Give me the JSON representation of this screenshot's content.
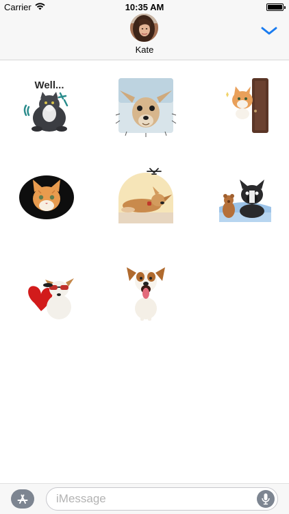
{
  "status_bar": {
    "carrier": "Carrier",
    "time": "10:35 AM",
    "icons": [
      "wifi-icon",
      "battery-icon"
    ],
    "battery_level": 1.0
  },
  "header": {
    "contact_name": "Kate",
    "collapse_icon": "chevron-down-icon",
    "accent_color": "#1a7cf0"
  },
  "stickers": [
    {
      "name": "sticker-fat-cat-well",
      "caption": "Well..."
    },
    {
      "name": "sticker-chihuahua-closeup",
      "caption": ""
    },
    {
      "name": "sticker-cat-peeking-door",
      "caption": ""
    },
    {
      "name": "sticker-kitten-oval",
      "caption": ""
    },
    {
      "name": "sticker-dog-lying",
      "caption": ""
    },
    {
      "name": "sticker-bulldog-teddy",
      "caption": ""
    },
    {
      "name": "sticker-dog-sunglasses-heart",
      "caption": ""
    },
    {
      "name": "sticker-jack-russell-tongue",
      "caption": ""
    }
  ],
  "input_bar": {
    "placeholder": "iMessage",
    "app_store_icon": "app-store-icon",
    "mic_icon": "microphone-icon"
  }
}
